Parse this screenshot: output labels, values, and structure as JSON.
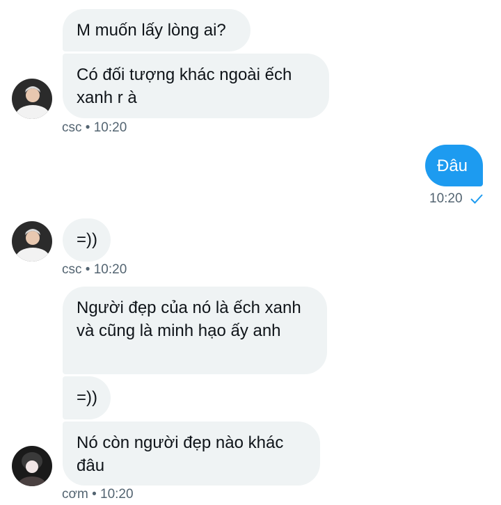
{
  "messages": [
    {
      "text": "M muốn lấy lòng ai?"
    },
    {
      "text": "Có đối tượng khác ngoài ếch xanh r à"
    },
    {
      "text": "Đâu"
    },
    {
      "text": "=))"
    },
    {
      "text": "Người đẹp của nó là ếch xanh và cũng là minh hạo ấy anh"
    },
    {
      "text": "=))"
    },
    {
      "text": "Nó còn người đẹp nào khác đâu"
    }
  ],
  "meta": {
    "group1": "csc • 10:20",
    "sent": "10:20",
    "group2": "csc • 10:20",
    "group3": "cơm • 10:20"
  },
  "icons": {
    "read_receipt": "check-icon",
    "read_receipt_color": "#1d9bf0"
  },
  "colors": {
    "incoming_bubble": "#eff3f4",
    "outgoing_bubble": "#1d9bf0",
    "meta_text": "#536471"
  }
}
